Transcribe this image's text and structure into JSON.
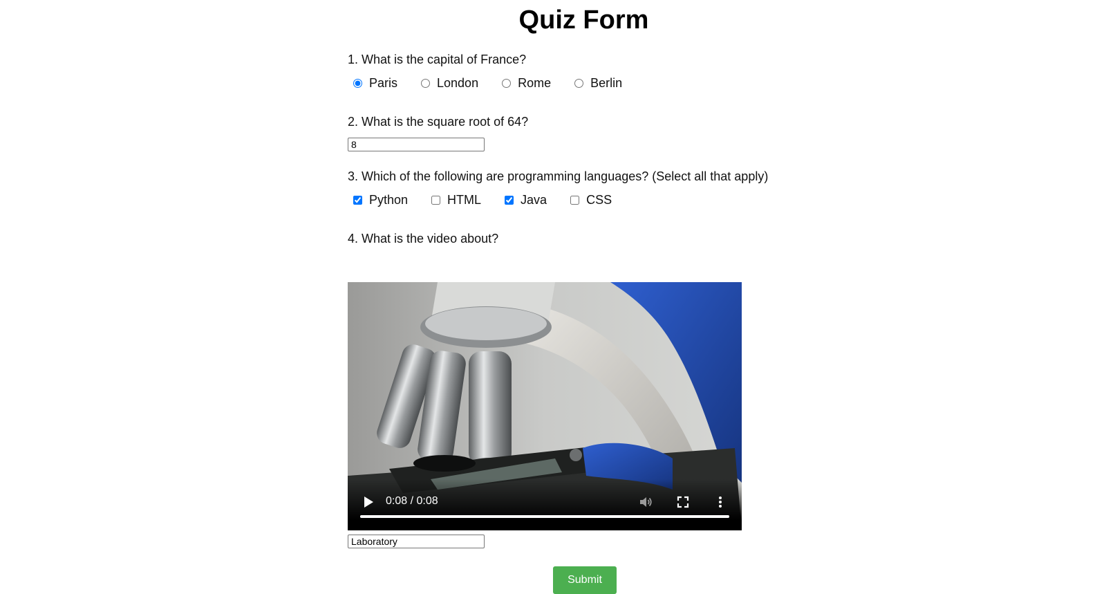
{
  "form": {
    "title": "Quiz Form",
    "submit_label": "Submit"
  },
  "q1": {
    "text": "1. What is the capital of France?",
    "options": [
      "Paris",
      "London",
      "Rome",
      "Berlin"
    ],
    "selected": "Paris"
  },
  "q2": {
    "text": "2. What is the square root of 64?",
    "value": "8"
  },
  "q3": {
    "text": "3. Which of the following are programming languages? (Select all that apply)",
    "options": [
      "Python",
      "HTML",
      "Java",
      "CSS"
    ],
    "checked": [
      "Python",
      "Java"
    ]
  },
  "q4": {
    "text": "4. What is the video about?",
    "video": {
      "time_display": "0:08 / 0:08",
      "progress_fraction": 1.0,
      "icons": [
        "play-icon",
        "volume-icon",
        "fullscreen-icon",
        "more-options-icon"
      ]
    },
    "value": "Laboratory"
  },
  "colors": {
    "submit_bg": "#4caf50",
    "accent": "#1a73e8"
  }
}
